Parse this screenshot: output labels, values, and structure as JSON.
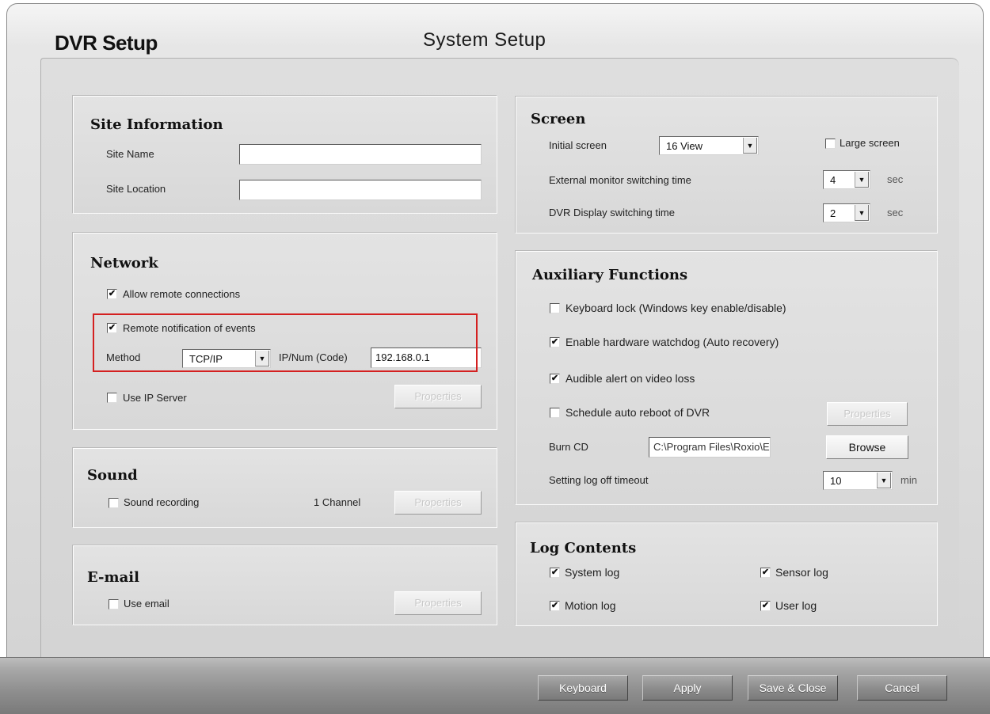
{
  "window": {
    "app_title": "DVR Setup",
    "page_title": "System Setup"
  },
  "site_information": {
    "title": "Site Information",
    "site_name_label": "Site Name",
    "site_name_value": "",
    "site_location_label": "Site Location",
    "site_location_value": ""
  },
  "network": {
    "title": "Network",
    "allow_remote_label": "Allow remote connections",
    "allow_remote_checked": true,
    "remote_notification_label": "Remote notification of events",
    "remote_notification_checked": true,
    "method_label": "Method",
    "method_value": "TCP/IP",
    "ipnum_label": "IP/Num (Code)",
    "ipnum_value": "192.168.0.1",
    "use_ip_server_label": "Use IP Server",
    "use_ip_server_checked": false,
    "properties_label": "Properties"
  },
  "sound": {
    "title": "Sound",
    "sound_recording_label": "Sound recording",
    "sound_recording_checked": false,
    "channel_text": "1 Channel",
    "properties_label": "Properties"
  },
  "email": {
    "title": "E-mail",
    "use_email_label": "Use email",
    "use_email_checked": false,
    "properties_label": "Properties"
  },
  "screen": {
    "title": "Screen",
    "initial_screen_label": "Initial screen",
    "initial_screen_value": "16 View",
    "large_screen_label": "Large screen",
    "large_screen_checked": false,
    "ext_monitor_label": "External monitor switching time",
    "ext_monitor_value": "4",
    "ext_monitor_unit": "sec",
    "dvr_display_label": "DVR Display switching time",
    "dvr_display_value": "2",
    "dvr_display_unit": "sec"
  },
  "auxiliary": {
    "title": "Auxiliary Functions",
    "keyboard_lock_label": "Keyboard lock (Windows key enable/disable)",
    "keyboard_lock_checked": false,
    "watchdog_label": "Enable hardware watchdog (Auto recovery)",
    "watchdog_checked": true,
    "audible_alert_label": "Audible alert on video loss",
    "audible_alert_checked": true,
    "auto_reboot_label": "Schedule auto reboot of DVR",
    "auto_reboot_checked": false,
    "properties_label": "Properties",
    "burn_cd_label": "Burn CD",
    "burn_cd_path": "C:\\Program Files\\Roxio\\Eas",
    "browse_label": "Browse",
    "logoff_label": "Setting log off timeout",
    "logoff_value": "10",
    "logoff_unit": "min"
  },
  "log_contents": {
    "title": "Log Contents",
    "system_log_label": "System log",
    "system_log_checked": true,
    "sensor_log_label": "Sensor log",
    "sensor_log_checked": true,
    "motion_log_label": "Motion log",
    "motion_log_checked": true,
    "user_log_label": "User log",
    "user_log_checked": true
  },
  "footer": {
    "keyboard": "Keyboard",
    "apply": "Apply",
    "save_close": "Save & Close",
    "cancel": "Cancel"
  },
  "colors": {
    "highlight_border": "#d42020",
    "footer_bar": "#8e8e8e"
  },
  "icons": {
    "dropdown": "chevron-down-icon",
    "checkmark": "checkmark-icon"
  }
}
